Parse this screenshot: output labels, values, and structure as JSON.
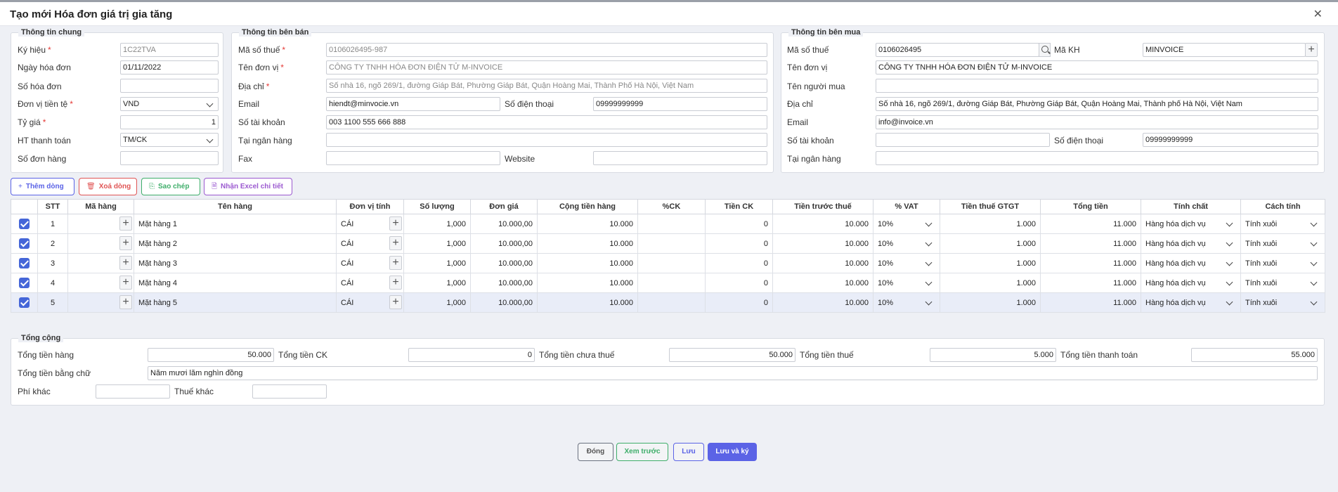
{
  "window": {
    "title": "Tạo mới Hóa đơn giá trị gia tăng",
    "close": "✕"
  },
  "general": {
    "legend": "Thông tin chung",
    "fields": {
      "ky_hieu": {
        "label": "Ký hiệu",
        "value": "1C22TVA"
      },
      "ngay_hd": {
        "label": "Ngày hóa đơn",
        "value": "01/11/2022"
      },
      "so_hd": {
        "label": "Số hóa đơn",
        "value": ""
      },
      "don_vi_tien": {
        "label": "Đơn vị tiền tệ",
        "value": "VND"
      },
      "ty_gia": {
        "label": "Tỷ giá",
        "value": "1"
      },
      "ht_thanh_toan": {
        "label": "HT thanh toán",
        "value": "TM/CK"
      },
      "so_don_hang": {
        "label": "Số đơn hàng",
        "value": ""
      }
    }
  },
  "seller": {
    "legend": "Thông tin bên bán",
    "fields": {
      "mst": {
        "label": "Mã số thuế",
        "value": "0106026495-987"
      },
      "ten_dv": {
        "label": "Tên đơn vị",
        "value": "CÔNG TY TNHH HÓA ĐƠN ĐIỆN TỬ M-INVOICE"
      },
      "dia_chi": {
        "label": "Địa chỉ",
        "value": "Số nhà 16, ngõ 269/1, đường Giáp Bát, Phường Giáp Bát, Quận Hoàng Mai, Thành Phố Hà Nội, Việt Nam"
      },
      "email": {
        "label": "Email",
        "value": "hiendt@minvocie.vn"
      },
      "sdt": {
        "label": "Số điện thoại",
        "value": "09999999999"
      },
      "so_tk": {
        "label": "Số tài khoản",
        "value": "003 1100 555 666 888"
      },
      "ngan_hang": {
        "label": "Tại ngân hàng",
        "value": ""
      },
      "fax": {
        "label": "Fax",
        "value": ""
      },
      "website": {
        "label": "Website",
        "value": ""
      }
    }
  },
  "buyer": {
    "legend": "Thông tin bên mua",
    "fields": {
      "mst": {
        "label": "Mã số thuế",
        "value": "0106026495"
      },
      "ma_kh": {
        "label": "Mã KH",
        "value": "MINVOICE"
      },
      "ten_dv": {
        "label": "Tên đơn vị",
        "value": "CÔNG TY TNHH HÓA ĐƠN ĐIỆN TỬ M-INVOICE"
      },
      "nguoi_mua": {
        "label": "Tên người mua",
        "value": ""
      },
      "dia_chi": {
        "label": "Địa chỉ",
        "value": "Số nhà 16, ngõ 269/1, đường Giáp Bát, Phường Giáp Bát, Quận Hoàng Mai, Thành phố Hà Nội, Việt Nam"
      },
      "email": {
        "label": "Email",
        "value": "info@invoice.vn"
      },
      "so_tk": {
        "label": "Số tài khoản",
        "value": ""
      },
      "sdt": {
        "label": "Số điện thoại",
        "value": "09999999999"
      },
      "ngan_hang": {
        "label": "Tại ngân hàng",
        "value": ""
      }
    }
  },
  "toolbar": {
    "add": "Thêm dòng",
    "delete": "Xoá dòng",
    "copy": "Sao chép",
    "excel": "Nhận Excel chi tiết"
  },
  "grid": {
    "headers": [
      "STT",
      "Mã hàng",
      "Tên hàng",
      "Đơn vị tính",
      "Số lượng",
      "Đơn giá",
      "Cộng tiền hàng",
      "%CK",
      "Tiền CK",
      "Tiền trước thuế",
      "% VAT",
      "Tiền thuế GTGT",
      "Tổng tiền",
      "Tính chất",
      "Cách tính"
    ],
    "rows": [
      {
        "stt": "1",
        "ten": "Mặt hàng 1",
        "dvt": "CÁI",
        "sl": "1,000",
        "dg": "10.000,00",
        "cong": "10.000",
        "ck": "",
        "tienck": "0",
        "truocthue": "10.000",
        "vat": "10%",
        "thue": "1.000",
        "tong": "11.000",
        "tinhchat": "Hàng hóa dịch vụ",
        "cachtinh": "Tính xuôi"
      },
      {
        "stt": "2",
        "ten": "Mặt hàng 2",
        "dvt": "CÁI",
        "sl": "1,000",
        "dg": "10.000,00",
        "cong": "10.000",
        "ck": "",
        "tienck": "0",
        "truocthue": "10.000",
        "vat": "10%",
        "thue": "1.000",
        "tong": "11.000",
        "tinhchat": "Hàng hóa dịch vụ",
        "cachtinh": "Tính xuôi"
      },
      {
        "stt": "3",
        "ten": "Mặt hàng 3",
        "dvt": "CÁI",
        "sl": "1,000",
        "dg": "10.000,00",
        "cong": "10.000",
        "ck": "",
        "tienck": "0",
        "truocthue": "10.000",
        "vat": "10%",
        "thue": "1.000",
        "tong": "11.000",
        "tinhchat": "Hàng hóa dịch vụ",
        "cachtinh": "Tính xuôi"
      },
      {
        "stt": "4",
        "ten": "Mặt hàng 4",
        "dvt": "CÁI",
        "sl": "1,000",
        "dg": "10.000,00",
        "cong": "10.000",
        "ck": "",
        "tienck": "0",
        "truocthue": "10.000",
        "vat": "10%",
        "thue": "1.000",
        "tong": "11.000",
        "tinhchat": "Hàng hóa dịch vụ",
        "cachtinh": "Tính xuôi"
      },
      {
        "stt": "5",
        "ten": "Mặt hàng 5",
        "dvt": "CÁI",
        "sl": "1,000",
        "dg": "10.000,00",
        "cong": "10.000",
        "ck": "",
        "tienck": "0",
        "truocthue": "10.000",
        "vat": "10%",
        "thue": "1.000",
        "tong": "11.000",
        "tinhchat": "Hàng hóa dịch vụ",
        "cachtinh": "Tính xuôi"
      }
    ]
  },
  "totals": {
    "legend": "Tổng cộng",
    "tong_tien_hang": {
      "label": "Tổng tiền hàng",
      "value": "50.000"
    },
    "tong_ck": {
      "label": "Tổng tiền CK",
      "value": "0"
    },
    "chua_thue": {
      "label": "Tổng tiền chưa thuế",
      "value": "50.000"
    },
    "tien_thue": {
      "label": "Tổng tiền thuế",
      "value": "5.000"
    },
    "thanh_toan": {
      "label": "Tổng tiền thanh toán",
      "value": "55.000"
    },
    "bang_chu": {
      "label": "Tổng tiền bằng chữ",
      "value": "Năm mươi lăm nghìn đồng"
    },
    "phi_khac": {
      "label": "Phí khác",
      "value": ""
    },
    "thue_khac": {
      "label": "Thuế khác",
      "value": ""
    }
  },
  "footer": {
    "close": "Đóng",
    "preview": "Xem trước",
    "save": "Lưu",
    "save_sign": "Lưu và ký"
  },
  "colors": {
    "accent": "#5b63e6",
    "checkbox": "#4566d8",
    "danger": "#e05555",
    "success": "#3fae6a",
    "purple": "#9b59d0"
  }
}
